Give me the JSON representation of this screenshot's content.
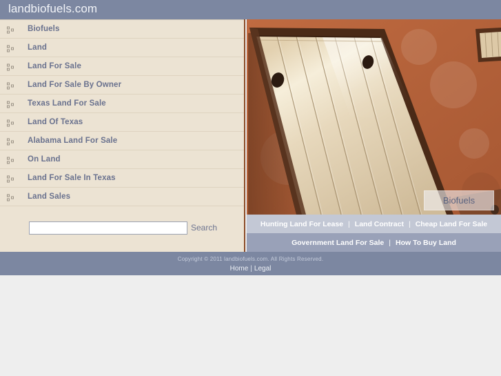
{
  "header": {
    "site_title": "landbiofuels.com",
    "background_color": "#7c87a1"
  },
  "sidebar": {
    "background_color": "#ece3d3",
    "accent_border_color": "#8b4a26",
    "nav_items": [
      {
        "label": "Biofuels",
        "icon": "list-bullet-icon"
      },
      {
        "label": "Land",
        "icon": "list-bullet-icon"
      },
      {
        "label": "Land For Sale",
        "icon": "list-bullet-icon"
      },
      {
        "label": "Land For Sale By Owner",
        "icon": "list-bullet-icon"
      },
      {
        "label": "Texas Land For Sale",
        "icon": "list-bullet-icon"
      },
      {
        "label": "Land Of Texas",
        "icon": "list-bullet-icon"
      },
      {
        "label": "Alabama Land For Sale",
        "icon": "list-bullet-icon"
      },
      {
        "label": "On Land",
        "icon": "list-bullet-icon"
      },
      {
        "label": "Land For Sale In Texas",
        "icon": "list-bullet-icon"
      },
      {
        "label": "Land Sales",
        "icon": "list-bullet-icon"
      }
    ],
    "search": {
      "value": "",
      "placeholder": "",
      "button_label": "Search"
    }
  },
  "hero": {
    "caption": "Biofuels",
    "alt_description": "Wooden plank door with dark hinges on a terracotta stucco wall",
    "wall_color": "#b5653b",
    "door_color": "#e0cfb2"
  },
  "footer_links": {
    "row_one": [
      {
        "label": "Hunting Land For Lease"
      },
      {
        "label": "Land Contract"
      },
      {
        "label": "Cheap Land For Sale"
      }
    ],
    "row_two": [
      {
        "label": "Government Land For Sale"
      },
      {
        "label": "How To Buy Land"
      }
    ],
    "separator": "|",
    "row_one_background": "#c3c8d5",
    "row_two_background": "#99a1b8"
  },
  "site_footer": {
    "copyright": "Copyright © 2011 landbiofuels.com. All Rights Reserved.",
    "links": [
      {
        "label": "Home"
      },
      {
        "label": "Legal"
      }
    ],
    "separator": "|",
    "background_color": "#7c87a1"
  }
}
